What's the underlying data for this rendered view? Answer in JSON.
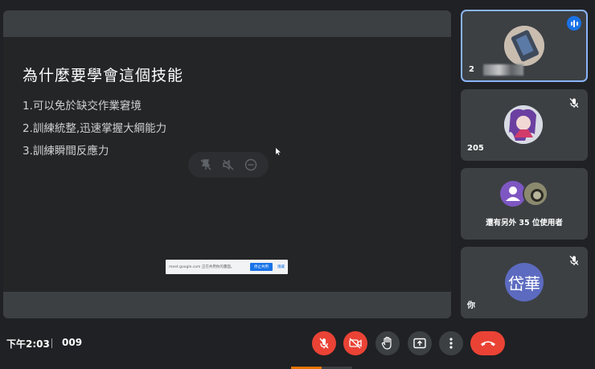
{
  "presentation": {
    "title": "為什麼要學會這個技能",
    "points": [
      "1.可以免於缺交作業窘境",
      "2.訓練統整,迅速掌握大綱能力",
      "3.訓練瞬間反應力"
    ],
    "share_banner": {
      "text": "meet.google.com 正在共用你的畫面。",
      "stop_label": "停止共用",
      "hide_label": "隱藏"
    }
  },
  "participants": [
    {
      "name": "2",
      "speaking": true,
      "muted": false,
      "avatar": "photo-avatar"
    },
    {
      "name": "205",
      "speaking": false,
      "muted": true,
      "avatar": "anime-avatar"
    },
    {
      "more_text": "還有另外 35 位使用者"
    },
    {
      "name": "你",
      "initials": "岱華",
      "muted": true,
      "avatar_color": "#5c6bc0"
    }
  ],
  "meeting": {
    "time": "下午2:03",
    "code": "009"
  },
  "colors": {
    "background": "#202124",
    "tile": "#3c4043",
    "danger": "#ea4335",
    "accent": "#1a73e8",
    "active_border": "#8ab4f8"
  },
  "icons": {
    "mic": "mic-off-icon",
    "camera": "camera-off-icon",
    "hand": "raise-hand-icon",
    "present": "present-screen-icon",
    "more": "more-vertical-icon",
    "end": "end-call-icon"
  }
}
